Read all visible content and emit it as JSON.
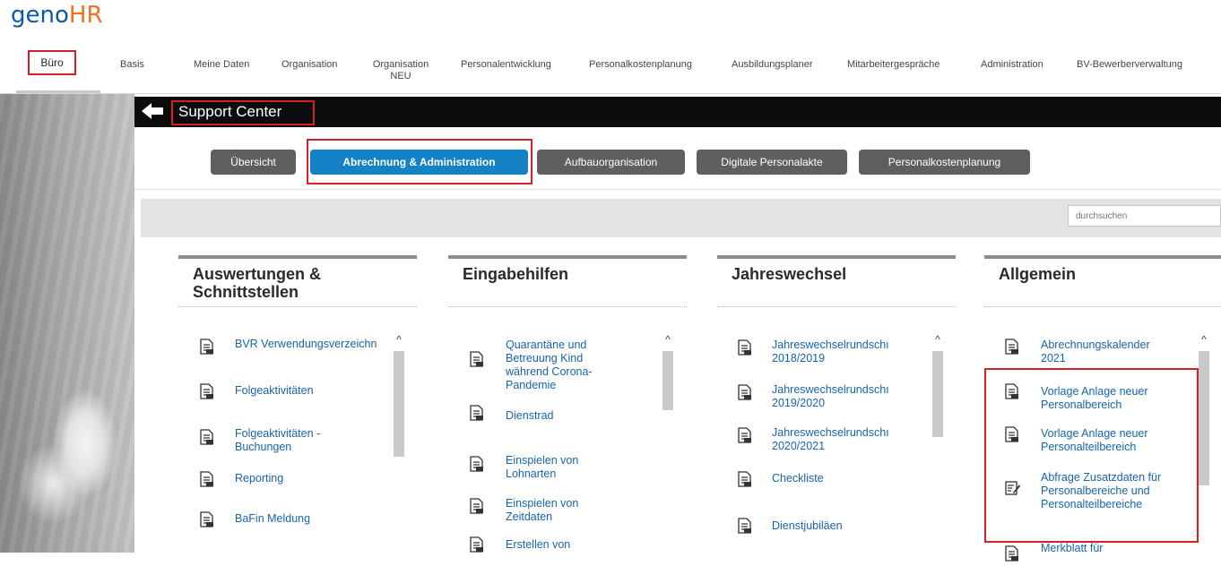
{
  "logo": {
    "part1": "geno",
    "part2": "HR"
  },
  "nav": {
    "items": [
      "Büro",
      "Basis",
      "Meine Daten",
      "Organisation",
      "Organisation NEU",
      "Personalentwicklung",
      "Personalkostenplanung",
      "Ausbildungsplaner",
      "Mitarbeitergespräche",
      "Administration",
      "BV-Bewerberverwaltung"
    ]
  },
  "page": {
    "title": "Support Center"
  },
  "tabs": [
    "Übersicht",
    "Abrechnung & Administration",
    "Aufbauorganisation",
    "Digitale Personalakte",
    "Personalkostenplanung"
  ],
  "search": {
    "placeholder": "durchsuchen"
  },
  "panels": [
    {
      "title": "Auswertungen & Schnittstellen",
      "entries": [
        "BVR Verwendungsverzeichn",
        "Folgeaktivitäten",
        "Folgeaktivitäten - Buchungen",
        "Reporting",
        "BaFin Meldung"
      ]
    },
    {
      "title": "Eingabehilfen",
      "entries": [
        "Quarantäne und Betreuung Kind während Corona-Pandemie",
        "Dienstrad",
        "Einspielen von Lohnarten",
        "Einspielen von Zeitdaten",
        "Erstellen von"
      ]
    },
    {
      "title": "Jahreswechsel",
      "entries": [
        "Jahreswechselrundschı 2018/2019",
        "Jahreswechselrundschı 2019/2020",
        "Jahreswechselrundschı 2020/2021",
        "Checkliste",
        "Dienstjubiläen"
      ]
    },
    {
      "title": "Allgemein",
      "entries": [
        "Abrechnungskalender 2021",
        "Vorlage Anlage neuer Personalbereich",
        "Vorlage Anlage neuer Personalteilbereich",
        "Abfrage Zusatzdaten für Personalbereiche und Personalteilbereiche",
        "Merkblatt für"
      ]
    }
  ],
  "colors": {
    "accent": "#1582c5",
    "highlight": "#d42027",
    "link": "#1664ad",
    "logo_blue": "#0c5aa6",
    "logo_orange": "#f36f21"
  }
}
